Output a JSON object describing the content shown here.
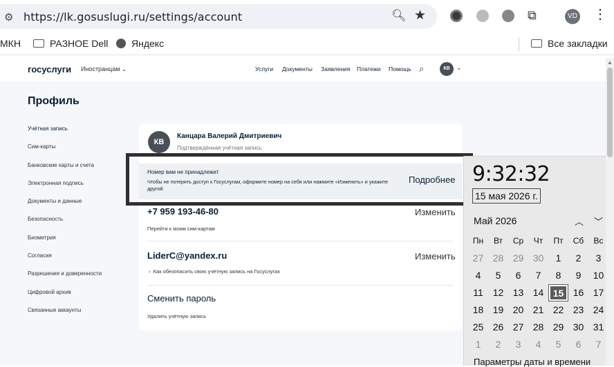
{
  "browser": {
    "url": "https://lk.gosuslugi.ru/settings/account",
    "profile_initials": "VD",
    "bookmarks": [
      "МКН",
      "РАЗНОЕ Dell",
      "Яндекс"
    ],
    "all_bookmarks": "Все закладки"
  },
  "header": {
    "logo": "госуслуги",
    "lang": "Иностранцам",
    "nav": [
      "Услуги",
      "Документы",
      "Заявления",
      "Платежи",
      "Помощь"
    ],
    "avatar_initials": "КВ"
  },
  "page": {
    "title": "Профиль",
    "sidebar": [
      "Учётная запись",
      "Сим-карты",
      "Банковские карты и счета",
      "Электронная подпись",
      "Документы и данные",
      "Безопасность",
      "Биометрия",
      "Согласия",
      "Разрешения и доверенности",
      "Цифровой архив",
      "Связанные аккаунты"
    ]
  },
  "account": {
    "avatar_initials": "КВ",
    "name": "Канцара Валерий Дмитриевич",
    "status": "Подтверждённая учётная запись",
    "alert_title": "Номер вам не принадлежит",
    "alert_text": "Чтобы не потерять доступ к Госуслугам, оформите номер на себя или нажмите «Изменить» и укажите другой",
    "alert_link": "Подробнее",
    "phone": "+7 959 193-46-80",
    "change_label": "Изменить",
    "sim_link": "Перейти к моим сим-картам",
    "email": "LiderC@yandex.ru",
    "protect_link": "Как обезопасить свою учётную запись на Госуслугах",
    "password_label": "Сменить пароль",
    "delete_link": "Удалить учётную запись"
  },
  "clock": {
    "time": "9:32:32",
    "date": "15 мая 2026 г.",
    "month": "Май 2026",
    "weekdays": [
      "Пн",
      "Вт",
      "Ср",
      "Чт",
      "Пт",
      "Сб",
      "Вс"
    ],
    "days": [
      {
        "d": "27",
        "cur": false
      },
      {
        "d": "28",
        "cur": false
      },
      {
        "d": "29",
        "cur": false
      },
      {
        "d": "30",
        "cur": false
      },
      {
        "d": "1",
        "cur": true
      },
      {
        "d": "2",
        "cur": true
      },
      {
        "d": "3",
        "cur": true
      },
      {
        "d": "4",
        "cur": true
      },
      {
        "d": "5",
        "cur": true
      },
      {
        "d": "6",
        "cur": true
      },
      {
        "d": "7",
        "cur": true
      },
      {
        "d": "8",
        "cur": true
      },
      {
        "d": "9",
        "cur": true
      },
      {
        "d": "10",
        "cur": true
      },
      {
        "d": "11",
        "cur": true
      },
      {
        "d": "12",
        "cur": true
      },
      {
        "d": "13",
        "cur": true
      },
      {
        "d": "14",
        "cur": true
      },
      {
        "d": "15",
        "cur": true,
        "today": true
      },
      {
        "d": "16",
        "cur": true
      },
      {
        "d": "17",
        "cur": true
      },
      {
        "d": "18",
        "cur": true
      },
      {
        "d": "19",
        "cur": true
      },
      {
        "d": "20",
        "cur": true
      },
      {
        "d": "21",
        "cur": true
      },
      {
        "d": "22",
        "cur": true
      },
      {
        "d": "23",
        "cur": true
      },
      {
        "d": "24",
        "cur": true
      },
      {
        "d": "25",
        "cur": true
      },
      {
        "d": "26",
        "cur": true
      },
      {
        "d": "27",
        "cur": true
      },
      {
        "d": "28",
        "cur": true
      },
      {
        "d": "29",
        "cur": true
      },
      {
        "d": "30",
        "cur": true
      },
      {
        "d": "31",
        "cur": true
      },
      {
        "d": "1",
        "cur": false
      },
      {
        "d": "2",
        "cur": false
      },
      {
        "d": "3",
        "cur": false
      },
      {
        "d": "4",
        "cur": false
      },
      {
        "d": "5",
        "cur": false
      },
      {
        "d": "6",
        "cur": false
      },
      {
        "d": "7",
        "cur": false
      }
    ],
    "footer": "Параметры даты и времени"
  }
}
